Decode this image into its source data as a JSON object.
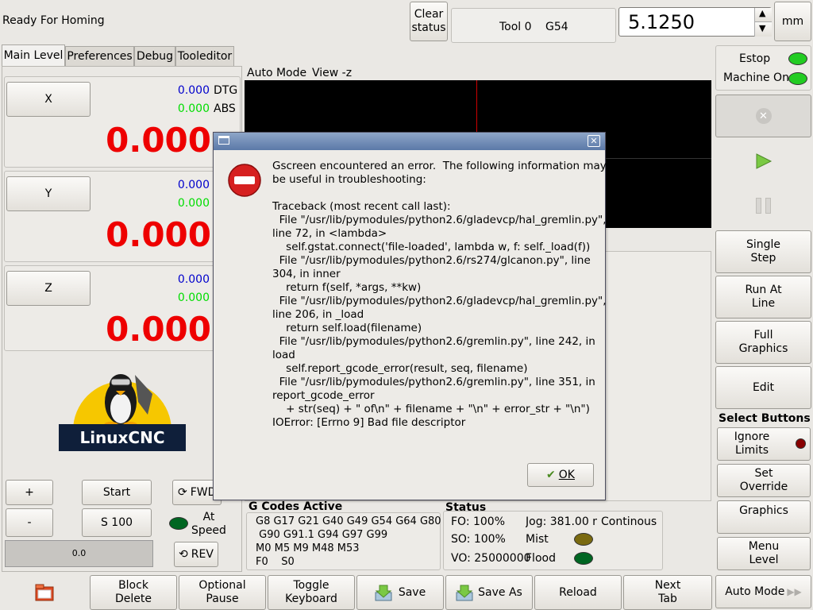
{
  "header": {
    "machine_status": "Ready For Homing",
    "clear_status_label": "Clear\nstatus",
    "tool_label": "Tool 0",
    "coord_system": "G54",
    "spin_value": "5.1250",
    "units_label": "mm"
  },
  "tabs": [
    "Main Level",
    "Preferences",
    "Debug",
    "Tooleditor"
  ],
  "axes": [
    {
      "label": "X",
      "dtg": "0.000",
      "dtg_label": "DTG",
      "abs": "0.000",
      "abs_label": "ABS",
      "value": "0.000"
    },
    {
      "label": "Y",
      "dtg": "0.000",
      "abs": "0.000",
      "value": "0.000"
    },
    {
      "label": "Z",
      "dtg": "0.000",
      "abs": "0.000",
      "value": "0.000"
    }
  ],
  "logo_text": "LinuxCNC",
  "spindle": {
    "plus_label": "+",
    "minus_label": "-",
    "start_label": "Start",
    "speed_label": "S 100",
    "fwd_label": "FWD",
    "at_speed_label": "At\nSpeed",
    "rev_label": "REV",
    "bar_value": "0.0"
  },
  "graphics": {
    "mode_label": "Auto Mode",
    "view_label": "View -z"
  },
  "gcodes": {
    "title": "G Codes Active",
    "lines": [
      "G8 G17 G21 G40 G49 G54 G64 G80",
      " G90 G91.1 G94 G97 G99",
      "M0 M5 M9 M48 M53",
      "F0    S0"
    ]
  },
  "status": {
    "title": "Status",
    "fo": "FO: 100%",
    "so": "SO: 100%",
    "vo": "VO: 25000000",
    "jog": "Jog: 381.00 m",
    "jog_mode": "Continous",
    "mist": "Mist",
    "flood": "Flood"
  },
  "right": {
    "estop_label": "Estop",
    "machine_on_label": "Machine On",
    "single_step_label": "Single\nStep",
    "run_at_line_label": "Run At\nLine",
    "full_graphics_label": "Full\nGraphics",
    "edit_label": "Edit",
    "select_buttons_label": "Select Buttons",
    "ignore_limits_label": "Ignore\nLimits",
    "set_override_label": "Set\nOverride",
    "graphics_label": "Graphics",
    "menu_level_label": "Menu\nLevel"
  },
  "bottom": {
    "block_delete": "Block\nDelete",
    "optional_pause": "Optional\nPause",
    "toggle_keyboard": "Toggle\nKeyboard",
    "save": "Save",
    "save_as": "Save As",
    "reload": "Reload",
    "next_tab": "Next\nTab",
    "auto_mode": "Auto Mode"
  },
  "dialog": {
    "message": "Gscreen encountered an error.  The following information may\nbe useful in troubleshooting:\n\nTraceback (most recent call last):\n  File \"/usr/lib/pymodules/python2.6/gladevcp/hal_gremlin.py\",\nline 72, in <lambda>\n    self.gstat.connect('file-loaded', lambda w, f: self._load(f))\n  File \"/usr/lib/pymodules/python2.6/rs274/glcanon.py\", line\n304, in inner\n    return f(self, *args, **kw)\n  File \"/usr/lib/pymodules/python2.6/gladevcp/hal_gremlin.py\",\nline 206, in _load\n    return self.load(filename)\n  File \"/usr/lib/pymodules/python2.6/gremlin.py\", line 242, in\nload\n    self.report_gcode_error(result, seq, filename)\n  File \"/usr/lib/pymodules/python2.6/gremlin.py\", line 351, in\nreport_gcode_error\n    + str(seq) + \" of\\n\" + filename + \"\\n\" + error_str + \"\\n\")\nIOError: [Errno 9] Bad file descriptor",
    "ok_label": "OK"
  },
  "colors": {
    "dro_red": "#ee0000",
    "abs_green": "#00dd00",
    "dtg_blue": "#0000cc",
    "led_green": "#22cc22",
    "led_dark_green": "#006622",
    "led_olive": "#7a6a10",
    "led_red": "#880000"
  }
}
